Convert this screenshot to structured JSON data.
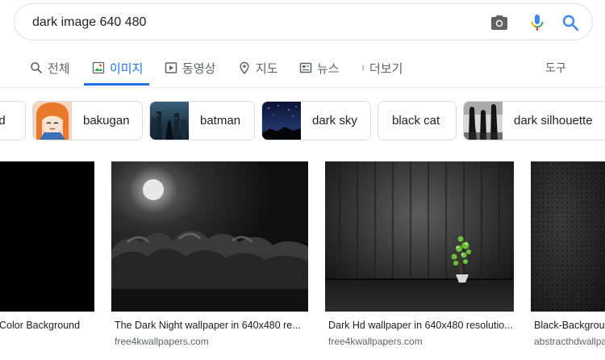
{
  "search": {
    "query": "dark image 640 480"
  },
  "tabs": [
    {
      "label": "전체",
      "icon": "search-icon"
    },
    {
      "label": "이미지",
      "icon": "image-icon",
      "active": true
    },
    {
      "label": "동영상",
      "icon": "play-icon"
    },
    {
      "label": "지도",
      "icon": "map-pin-icon"
    },
    {
      "label": "뉴스",
      "icon": "news-icon"
    },
    {
      "label": "더보기",
      "icon": "more-vert-icon"
    }
  ],
  "tools_label": "도구",
  "chips": [
    {
      "label": "nd"
    },
    {
      "label": "bakugan"
    },
    {
      "label": "batman"
    },
    {
      "label": "dark sky"
    },
    {
      "label": "black cat"
    },
    {
      "label": "dark silhouette"
    }
  ],
  "results": [
    {
      "title": "Color Background",
      "source": ""
    },
    {
      "title": "The Dark Night wallpaper in 640x480 re...",
      "source": "free4kwallpapers.com"
    },
    {
      "title": "Dark Hd wallpaper in 640x480 resolutio...",
      "source": "free4kwallpapers.com"
    },
    {
      "title": "Black-Backgrou",
      "source": "abstracthdwallpa"
    }
  ],
  "colors": {
    "accent": "#1a73e8",
    "mic_blue": "#4285f4",
    "mic_red": "#ea4335",
    "mic_yellow": "#fbbc04",
    "mic_green": "#34a853"
  }
}
